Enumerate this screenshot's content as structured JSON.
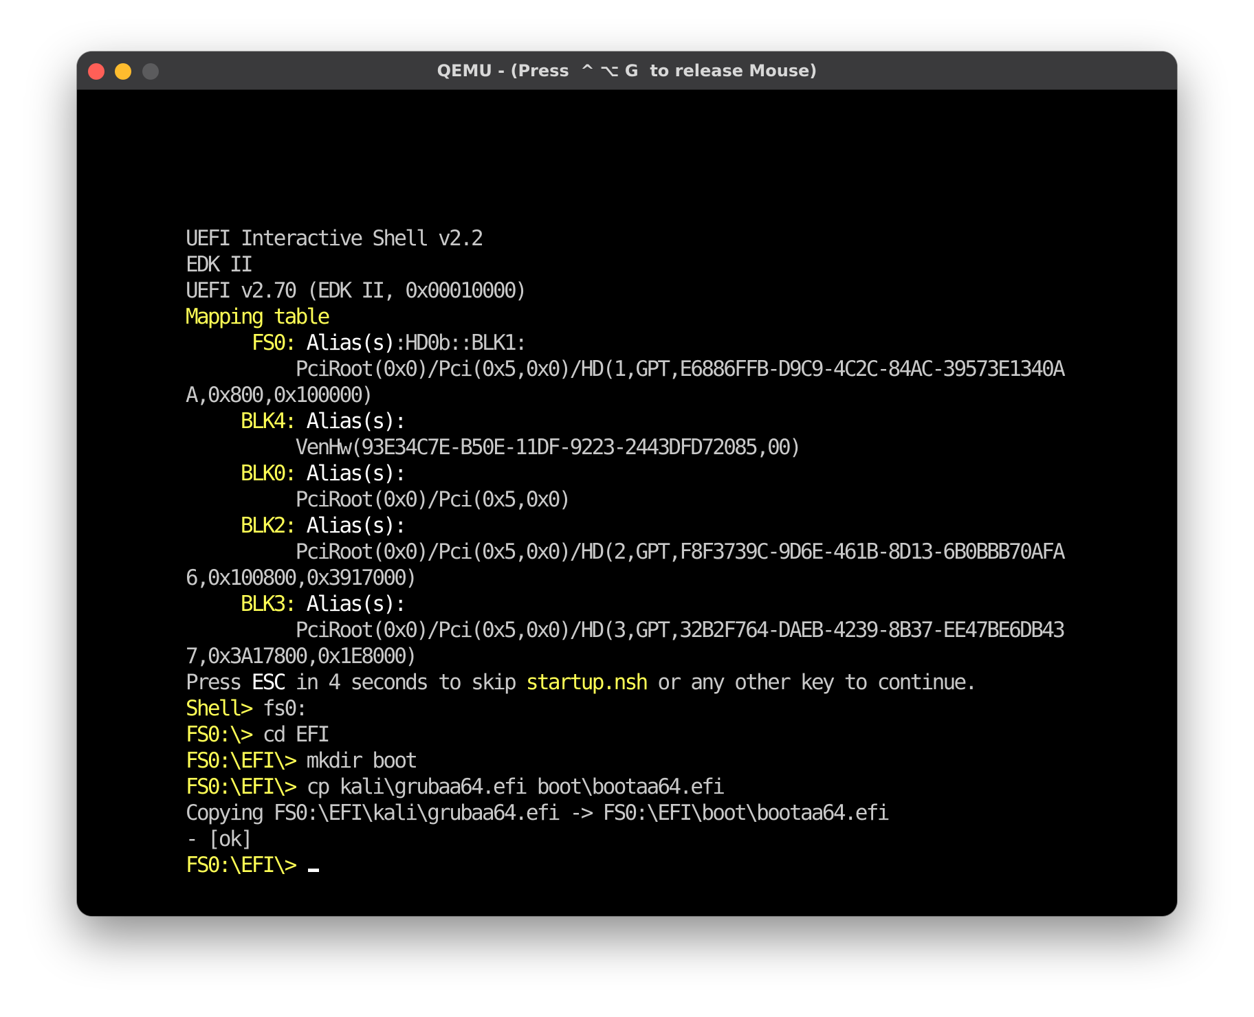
{
  "window": {
    "title": "QEMU - (Press  ^ ⌥ G  to release Mouse)",
    "controls": [
      "close",
      "minimize",
      "zoom"
    ]
  },
  "colors": {
    "text_default": "#c9c9c9",
    "text_highlight": "#ffff55",
    "text_bright": "#ffffff",
    "screen_background": "#000000",
    "titlebar": "#3a3a3c"
  },
  "console": {
    "lines": [
      [
        {
          "t": "UEFI Interactive Shell v2.2",
          "c": "g"
        }
      ],
      [
        {
          "t": "EDK II",
          "c": "g"
        }
      ],
      [
        {
          "t": "UEFI v2.70 (EDK II, 0x00010000)",
          "c": "g"
        }
      ],
      [
        {
          "t": "Mapping table",
          "c": "y"
        }
      ],
      [
        {
          "t": "      FS0: ",
          "c": "y"
        },
        {
          "t": "Alias(s)",
          "c": "w"
        },
        {
          "t": ":HD0b::BLK1:",
          "c": "g"
        }
      ],
      [
        {
          "t": "          PciRoot(0x0)/Pci(0x5,0x0)/HD(1,GPT,E6886FFB-D9C9-4C2C-84AC-39573E1340A",
          "c": "g"
        }
      ],
      [
        {
          "t": "A,0x800,0x100000)",
          "c": "g"
        }
      ],
      [
        {
          "t": "     BLK4: ",
          "c": "y"
        },
        {
          "t": "Alias(s):",
          "c": "w"
        }
      ],
      [
        {
          "t": "          VenHw(93E34C7E-B50E-11DF-9223-2443DFD72085,00)",
          "c": "g"
        }
      ],
      [
        {
          "t": "     BLK0: ",
          "c": "y"
        },
        {
          "t": "Alias(s):",
          "c": "w"
        }
      ],
      [
        {
          "t": "          PciRoot(0x0)/Pci(0x5,0x0)",
          "c": "g"
        }
      ],
      [
        {
          "t": "     BLK2: ",
          "c": "y"
        },
        {
          "t": "Alias(s):",
          "c": "w"
        }
      ],
      [
        {
          "t": "          PciRoot(0x0)/Pci(0x5,0x0)/HD(2,GPT,F8F3739C-9D6E-461B-8D13-6B0BBB70AFA",
          "c": "g"
        }
      ],
      [
        {
          "t": "6,0x100800,0x3917000)",
          "c": "g"
        }
      ],
      [
        {
          "t": "     BLK3: ",
          "c": "y"
        },
        {
          "t": "Alias(s):",
          "c": "w"
        }
      ],
      [
        {
          "t": "          PciRoot(0x0)/Pci(0x5,0x0)/HD(3,GPT,32B2F764-DAEB-4239-8B37-EE47BE6DB43",
          "c": "g"
        }
      ],
      [
        {
          "t": "7,0x3A17800,0x1E8000)",
          "c": "g"
        }
      ],
      [
        {
          "t": "Press ",
          "c": "g"
        },
        {
          "t": "ESC",
          "c": "w"
        },
        {
          "t": " in 4 seconds to skip ",
          "c": "g"
        },
        {
          "t": "startup.nsh",
          "c": "y"
        },
        {
          "t": " or any other key to continue.",
          "c": "g"
        }
      ],
      [
        {
          "t": "Shell> ",
          "c": "y"
        },
        {
          "t": "fs0:",
          "c": "g"
        }
      ],
      [
        {
          "t": "FS0:\\> ",
          "c": "y"
        },
        {
          "t": "cd EFI",
          "c": "g"
        }
      ],
      [
        {
          "t": "FS0:\\EFI\\> ",
          "c": "y"
        },
        {
          "t": "mkdir boot",
          "c": "g"
        }
      ],
      [
        {
          "t": "FS0:\\EFI\\> ",
          "c": "y"
        },
        {
          "t": "cp kali\\grubaa64.efi boot\\bootaa64.efi",
          "c": "g"
        }
      ],
      [
        {
          "t": "Copying FS0:\\EFI\\kali\\grubaa64.efi -> FS0:\\EFI\\boot\\bootaa64.efi",
          "c": "g"
        }
      ],
      [
        {
          "t": "- [ok]",
          "c": "g"
        }
      ],
      [
        {
          "t": "FS0:\\EFI\\> ",
          "c": "y"
        }
      ]
    ]
  }
}
